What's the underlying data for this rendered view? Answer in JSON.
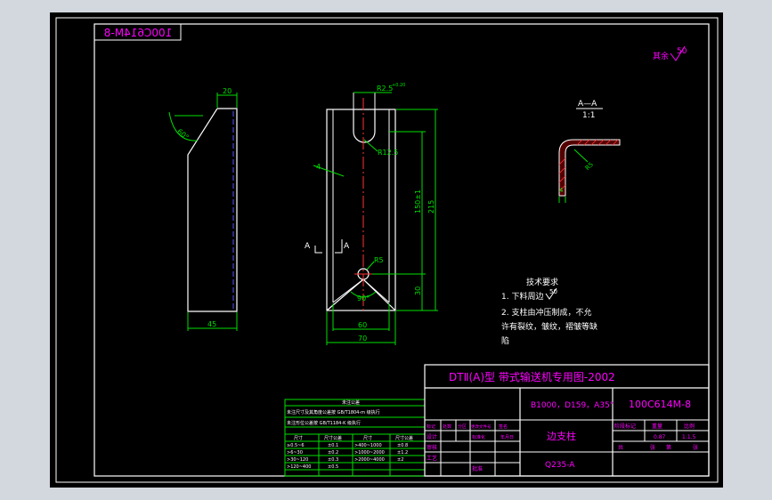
{
  "colors": {
    "background": "#d3d8df",
    "canvas": "#000000",
    "frame": "#ffffff",
    "dimension": "#00e000",
    "outline": "#ffffff",
    "text": "#ff00ff",
    "centerline": "#ff3333",
    "hidden": "#5555ff",
    "hatch": "#ff3333"
  },
  "drawing_code_mirrored": "100C614M-8",
  "roughness": {
    "label": "其余",
    "value": "50"
  },
  "front_view": {
    "top_dim": "20",
    "angle": "60°",
    "bottom_dim": "45"
  },
  "side_view": {
    "top_dim": "R2.5",
    "top_tol": "+0.20",
    "radius_r125": "R12.5",
    "hole_r5": "R5",
    "angle": "90°",
    "section_mark": "A",
    "dim_150": "150±1",
    "dim_215": "215",
    "dim_30": "30",
    "dim_60": "60",
    "dim_70": "70"
  },
  "section_view": {
    "title": "A—A",
    "scale": "1:1",
    "radius": "R5",
    "thickness": "4"
  },
  "tech_req": {
    "title": "技术要求",
    "line1": "1. 下料周边",
    "line1_value": "50",
    "line2": "2. 支柱由冲压制成，不允",
    "line3": "许有裂纹，皱纹，褶皱等缺",
    "line4": "陷"
  },
  "tolerance_table": {
    "title": "未注公差",
    "line1": "未注尺寸及其角度公差按 GB/T1804-m 级执行",
    "line2": "未注形位公差按 GB/T1184-K 级执行",
    "header": [
      "尺寸",
      "尺寸公差",
      "尺寸",
      "尺寸公差"
    ],
    "rows": [
      [
        "≥0.5~6",
        "±0.1",
        ">400~1000",
        "±0.8"
      ],
      [
        ">6~30",
        "±0.2",
        ">1000~2000",
        "±1.2"
      ],
      [
        ">30~120",
        "±0.3",
        ">2000~4000",
        "±2"
      ],
      [
        ">120~400",
        "±0.5",
        "",
        ""
      ]
    ]
  },
  "title_block": {
    "title": "DTⅡ(A)型  带式输送机专用图-2002",
    "spec": "B1000，D159，A35°",
    "code": "100C614M-8",
    "name": "边支柱",
    "material": "Q235-A",
    "stage_label": "阶段标记",
    "weight_label": "重量",
    "scale_label": "比例",
    "weight": "0.87",
    "scale": "1:1.5",
    "sheets_label": "共",
    "sheet_label": "张",
    "sheet_no_label": "第",
    "col_labels": [
      "标记",
      "处数",
      "分区",
      "更改文件号",
      "签名",
      "年月日"
    ],
    "role_labels": [
      "设计",
      "审核",
      "工艺",
      "标准化",
      "批准"
    ]
  }
}
